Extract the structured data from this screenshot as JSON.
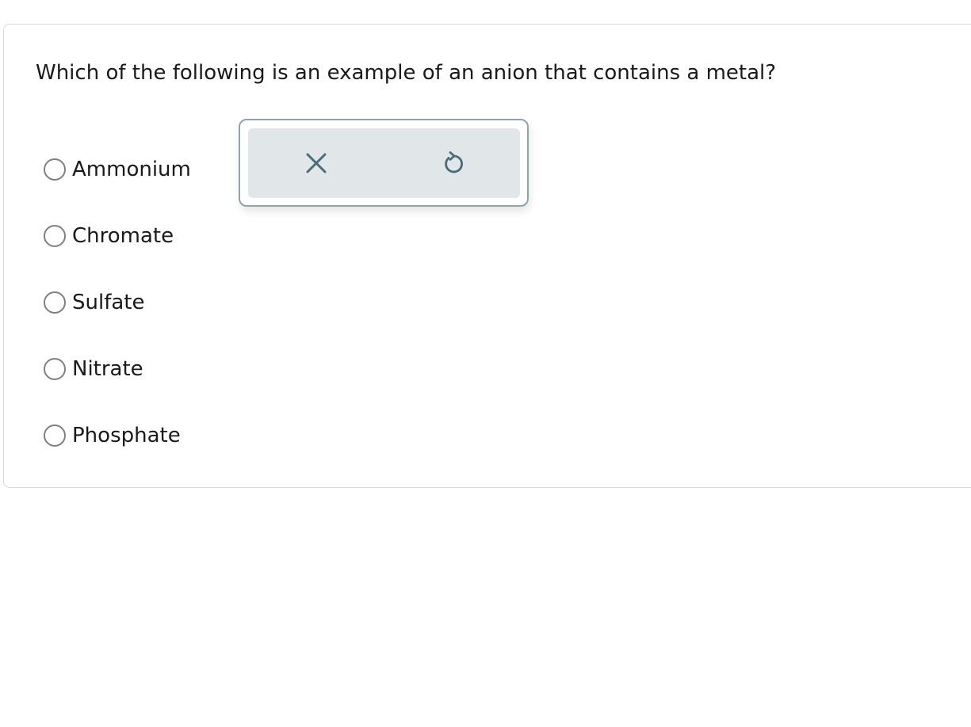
{
  "question": {
    "text": "Which of the following is an example of an anion that contains a metal?"
  },
  "options": [
    {
      "label": "Ammonium",
      "selected": false
    },
    {
      "label": "Chromate",
      "selected": false
    },
    {
      "label": "Sulfate",
      "selected": false
    },
    {
      "label": "Nitrate",
      "selected": false
    },
    {
      "label": "Phosphate",
      "selected": false
    }
  ],
  "toolbar": {
    "clear_icon": "close-icon",
    "undo_icon": "undo-icon",
    "icon_color": "#4a6c78"
  },
  "colors": {
    "radio_border": "#808080",
    "card_border": "#d5dde0",
    "toolbar_bg": "#e1e7e9"
  }
}
